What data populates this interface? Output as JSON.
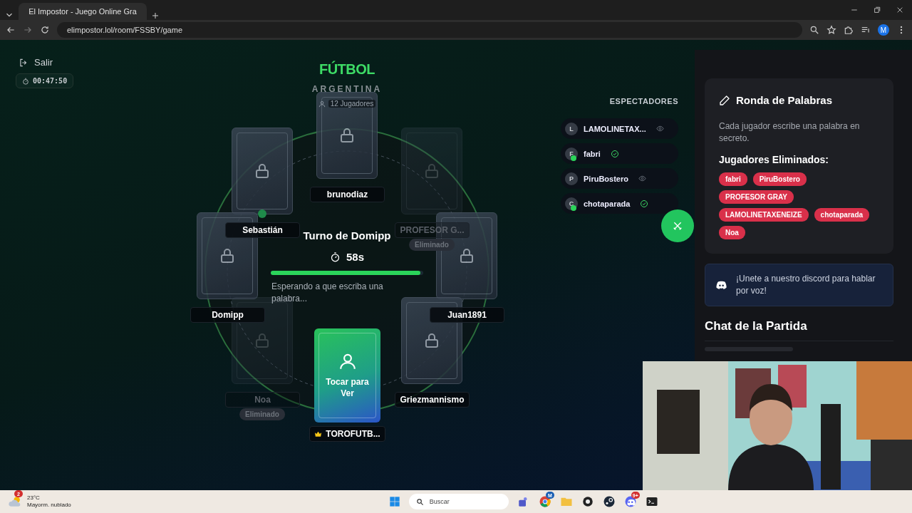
{
  "browser": {
    "tab_title": "El Impostor - Juego Online Gra",
    "url": "elimpostor.lol/room/FSSBY/game",
    "profile": "M"
  },
  "header": {
    "exit": "Salir",
    "elapsed": "00:47:50"
  },
  "game": {
    "category": "FÚTBOL",
    "subcategory": "ARGENTINA",
    "player_count": "12 Jugadores",
    "turn": "Turno de Domipp",
    "countdown": "58s",
    "level": 0.98,
    "status": "Esperando a que escriba una palabra..."
  },
  "players": [
    {
      "name": "brunodiaz",
      "kind": "locked",
      "eliminated": false,
      "host": false,
      "online": false
    },
    {
      "name": "Sebastián",
      "kind": "locked",
      "eliminated": false,
      "host": false,
      "online": true
    },
    {
      "name": "PROFESOR G...",
      "kind": "locked",
      "eliminated": true,
      "badge": "Eliminado",
      "host": false,
      "online": false
    },
    {
      "name": "Domipp",
      "kind": "locked",
      "eliminated": false,
      "host": false,
      "online": false
    },
    {
      "name": "Juan1891",
      "kind": "locked",
      "eliminated": false,
      "host": false,
      "online": false
    },
    {
      "name": "Noa",
      "kind": "locked",
      "eliminated": true,
      "badge": "Eliminado",
      "host": false,
      "online": false
    },
    {
      "name": "Griezmannismo",
      "kind": "locked",
      "eliminated": false,
      "host": false,
      "online": false
    },
    {
      "name": "TOROFUTB...",
      "kind": "reveal",
      "reveal_label": "Tocar para Ver",
      "eliminated": false,
      "host": true,
      "online": false
    }
  ],
  "spectators": {
    "title": "ESPECTADORES",
    "items": [
      {
        "initial": "L",
        "name": "LAMOLINETAX...",
        "ready": false,
        "online": false
      },
      {
        "initial": "F",
        "name": "fabri",
        "ready": true,
        "online": true
      },
      {
        "initial": "P",
        "name": "PiruBostero",
        "ready": false,
        "online": false
      },
      {
        "initial": "C",
        "name": "chotaparada",
        "ready": true,
        "online": true
      }
    ]
  },
  "panel": {
    "title": "Ronda de Palabras",
    "description": "Cada jugador escribe una palabra en secreto.",
    "eliminated_title": "Jugadores Eliminados:",
    "eliminated": [
      "fabri",
      "PiruBostero",
      "PROFESOR GRAY",
      "LAMOLINETAXENEIZE",
      "chotaparada",
      "Noa"
    ]
  },
  "discord": {
    "text": "¡Unete a nuestro discord para hablar por voz!"
  },
  "chat": {
    "title": "Chat de la Partida"
  },
  "taskbar": {
    "temperature": "23°C",
    "weather": "Mayorm. nublado",
    "weather_badge": "2",
    "search": "Buscar",
    "chrome_badge": "M",
    "discord_badge": "9+"
  }
}
